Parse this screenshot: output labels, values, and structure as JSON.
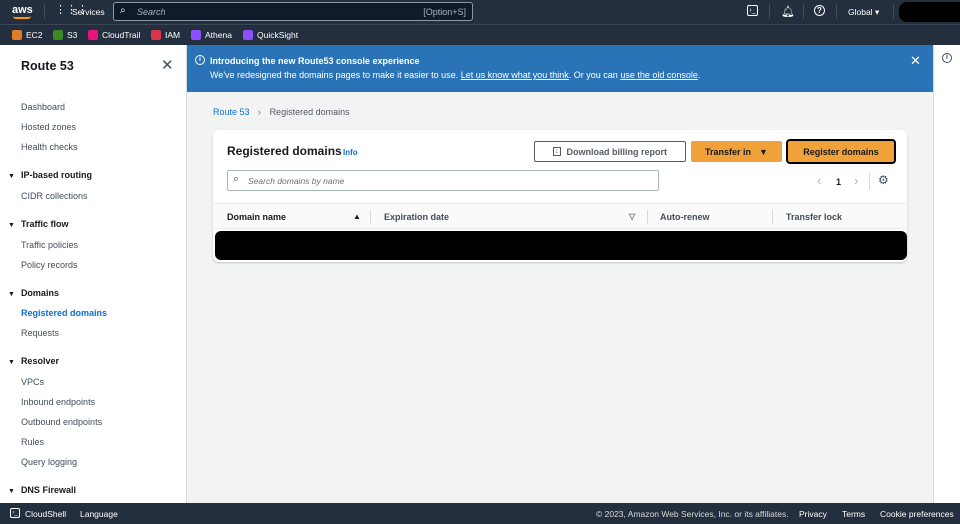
{
  "topnav": {
    "logo": "aws",
    "services": "Services",
    "search_placeholder": "Search",
    "search_shortcut": "[Option+S]",
    "region": "Global"
  },
  "favorites": [
    {
      "label": "EC2",
      "color": "#e07b26"
    },
    {
      "label": "S3",
      "color": "#3f8624"
    },
    {
      "label": "CloudTrail",
      "color": "#e7157b"
    },
    {
      "label": "IAM",
      "color": "#dd344c"
    },
    {
      "label": "Athena",
      "color": "#8c4fff"
    },
    {
      "label": "QuickSight",
      "color": "#8c4fff"
    }
  ],
  "sidebar": {
    "title": "Route 53",
    "items": [
      "Dashboard",
      "Hosted zones",
      "Health checks"
    ],
    "groups": [
      {
        "label": "IP-based routing",
        "items": [
          "CIDR collections"
        ]
      },
      {
        "label": "Traffic flow",
        "items": [
          "Traffic policies",
          "Policy records"
        ]
      },
      {
        "label": "Domains",
        "items": [
          "Registered domains",
          "Requests"
        ]
      },
      {
        "label": "Resolver",
        "items": [
          "VPCs",
          "Inbound endpoints",
          "Outbound endpoints",
          "Rules",
          "Query logging"
        ]
      },
      {
        "label": "DNS Firewall",
        "items": []
      }
    ],
    "active": "Registered domains"
  },
  "banner": {
    "title": "Introducing the new Route53 console experience",
    "text": "We've redesigned the domains pages to make it easier to use.",
    "link1": "Let us know what you think",
    "mid": ". Or you can",
    "link2": "use the old console",
    "end": "."
  },
  "breadcrumb": {
    "root": "Route 53",
    "current": "Registered domains"
  },
  "card": {
    "title": "Registered domains",
    "info": "Info",
    "download": "Download billing report",
    "transfer": "Transfer in",
    "register": "Register domains",
    "search_placeholder": "Search domains by name",
    "page": "1",
    "columns": [
      "Domain name",
      "Expiration date",
      "Auto-renew",
      "Transfer lock"
    ]
  },
  "footer": {
    "cloudshell": "CloudShell",
    "language": "Language",
    "copyright": "© 2023, Amazon Web Services, Inc. or its affiliates.",
    "privacy": "Privacy",
    "terms": "Terms",
    "cookies": "Cookie preferences"
  }
}
